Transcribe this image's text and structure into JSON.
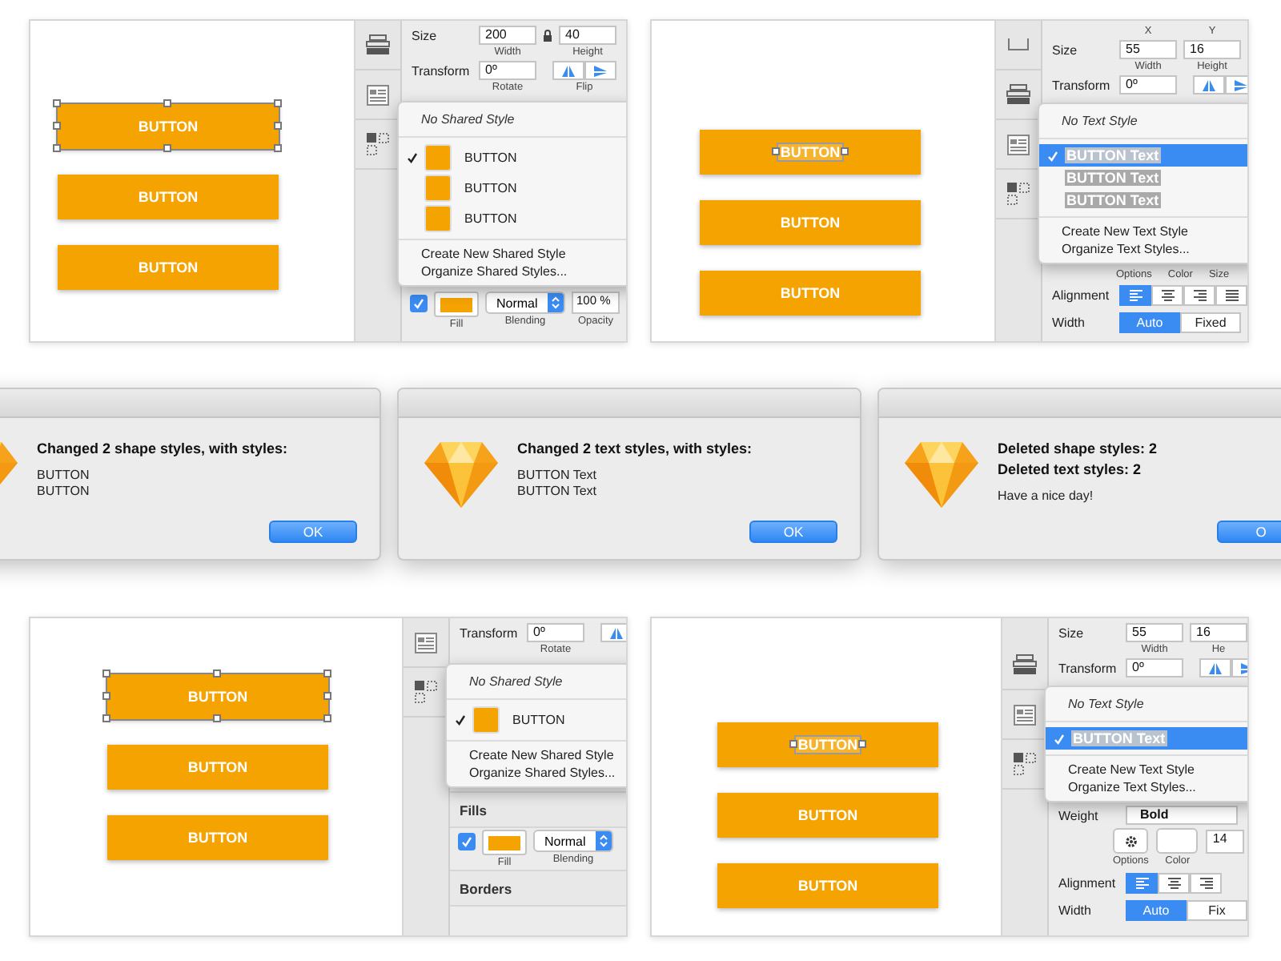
{
  "top_panels": [
    {
      "canvas_buttons": [
        {
          "label": "BUTTON",
          "selected": true,
          "text_selected": false
        },
        {
          "label": "BUTTON",
          "selected": false,
          "text_selected": false
        },
        {
          "label": "BUTTON",
          "selected": false,
          "text_selected": false
        }
      ],
      "inspector": [
        {
          "kind": "fields",
          "label": "Size",
          "locked": true,
          "fields": [
            {
              "value": "200",
              "caption": "Width"
            },
            {
              "value": "40",
              "caption": "Height"
            }
          ]
        },
        {
          "kind": "transform",
          "label": "Transform",
          "field": {
            "value": "0º",
            "caption": "Rotate"
          },
          "flip_caption": "Flip"
        },
        {
          "kind": "menu",
          "title": "No Shared Style",
          "items": [
            {
              "kind": "swatch",
              "label": "BUTTON",
              "checked": true,
              "selected": false
            },
            {
              "kind": "swatch",
              "label": "BUTTON",
              "checked": false,
              "selected": false
            },
            {
              "kind": "swatch",
              "label": "BUTTON",
              "checked": false,
              "selected": false
            }
          ],
          "actions": [
            "Create New Shared Style",
            "Organize Shared Styles..."
          ]
        },
        {
          "kind": "fill",
          "checked": true,
          "blending": "Normal",
          "opacity": "100 %",
          "captions": [
            "Fill",
            "Blending",
            "Opacity"
          ]
        }
      ]
    },
    {
      "canvas_buttons": [
        {
          "label": "BUTTON",
          "selected": false,
          "text_selected": true
        },
        {
          "label": "BUTTON",
          "selected": false,
          "text_selected": false
        },
        {
          "label": "BUTTON",
          "selected": false,
          "text_selected": false
        }
      ],
      "inspector": [
        {
          "kind": "captions",
          "captions": [
            "X",
            "Y"
          ]
        },
        {
          "kind": "fields",
          "label": "Size",
          "locked": false,
          "fields": [
            {
              "value": "55",
              "caption": "Width"
            },
            {
              "value": "16",
              "caption": "Height"
            }
          ]
        },
        {
          "kind": "transform",
          "label": "Transform",
          "field": {
            "value": "0º"
          }
        },
        {
          "kind": "menu",
          "title": "No Text Style",
          "items": [
            {
              "kind": "text-style",
              "label": "BUTTON Text",
              "checked": true,
              "selected": true
            },
            {
              "kind": "text-style",
              "label": "BUTTON Text",
              "checked": false,
              "selected": false
            },
            {
              "kind": "text-style",
              "label": "BUTTON Text",
              "checked": false,
              "selected": false
            }
          ],
          "actions": [
            "Create New Text Style",
            "Organize Text Styles..."
          ]
        },
        {
          "kind": "caption_line",
          "captions": [
            "Options",
            "Color",
            "Size"
          ]
        },
        {
          "kind": "alignment",
          "label": "Alignment",
          "options": [
            {
              "selected": true
            },
            {
              "selected": false
            },
            {
              "selected": false
            },
            {
              "selected": false
            }
          ]
        },
        {
          "kind": "segmented",
          "label": "Width",
          "options": [
            {
              "label": "Auto",
              "selected": true
            },
            {
              "label": "Fixed",
              "selected": false
            }
          ]
        }
      ]
    }
  ],
  "dialogs": [
    {
      "title_lines": [
        "Changed 2 shape styles, with styles:"
      ],
      "body_lines": [
        "BUTTON",
        "BUTTON"
      ],
      "button": "OK"
    },
    {
      "title_lines": [
        "Changed 2 text styles, with styles:"
      ],
      "body_lines": [
        "BUTTON Text",
        "BUTTON Text"
      ],
      "button": "OK"
    },
    {
      "title_lines": [
        "Deleted shape styles: 2",
        "Deleted text styles: 2"
      ],
      "body_lines": [
        "Have a nice day!"
      ],
      "button": "O"
    }
  ],
  "bottom_panels": [
    {
      "canvas_buttons": [
        {
          "label": "BUTTON",
          "selected": true,
          "text_selected": false
        },
        {
          "label": "BUTTON",
          "selected": false,
          "text_selected": false
        },
        {
          "label": "BUTTON",
          "selected": false,
          "text_selected": false
        }
      ],
      "inspector": [
        {
          "kind": "transform",
          "label": "Transform",
          "field": {
            "value": "0º",
            "caption": "Rotate"
          }
        },
        {
          "kind": "menu",
          "title": "No Shared Style",
          "items": [
            {
              "kind": "swatch",
              "label": "BUTTON",
              "checked": true,
              "selected": false
            }
          ],
          "actions": [
            "Create New Shared Style",
            "Organize Shared Styles..."
          ]
        },
        {
          "kind": "header",
          "label": "Fills"
        },
        {
          "kind": "fill",
          "checked": true,
          "blending": "Normal",
          "captions": [
            "Fill",
            "Blending"
          ]
        },
        {
          "kind": "header",
          "label": "Borders"
        }
      ]
    },
    {
      "canvas_buttons": [
        {
          "label": "BUTTON",
          "selected": false,
          "text_selected": true
        },
        {
          "label": "BUTTON",
          "selected": false,
          "text_selected": false
        },
        {
          "label": "BUTTON",
          "selected": false,
          "text_selected": false
        }
      ],
      "inspector": [
        {
          "kind": "fields",
          "label": "Size",
          "locked": false,
          "fields": [
            {
              "value": "55",
              "caption": "Width"
            },
            {
              "value": "16",
              "caption": "He"
            }
          ]
        },
        {
          "kind": "transform",
          "label": "Transform",
          "field": {
            "value": "0º"
          }
        },
        {
          "kind": "menu",
          "title": "No Text Style",
          "items": [
            {
              "kind": "text-style",
              "label": "BUTTON Text",
              "checked": true,
              "selected": true
            }
          ],
          "actions": [
            "Create New Text Style",
            "Organize Text Styles..."
          ]
        },
        {
          "kind": "weight",
          "label": "Weight",
          "value": "Bold"
        },
        {
          "kind": "text_options",
          "size": "14",
          "captions": [
            "Options",
            "Color"
          ]
        },
        {
          "kind": "alignment",
          "label": "Alignment",
          "options": [
            {
              "selected": true
            },
            {
              "selected": false
            },
            {
              "selected": false
            }
          ]
        },
        {
          "kind": "segmented",
          "label": "Width",
          "options": [
            {
              "label": "Auto",
              "selected": true
            },
            {
              "label": "Fix",
              "selected": false
            }
          ]
        }
      ]
    }
  ]
}
